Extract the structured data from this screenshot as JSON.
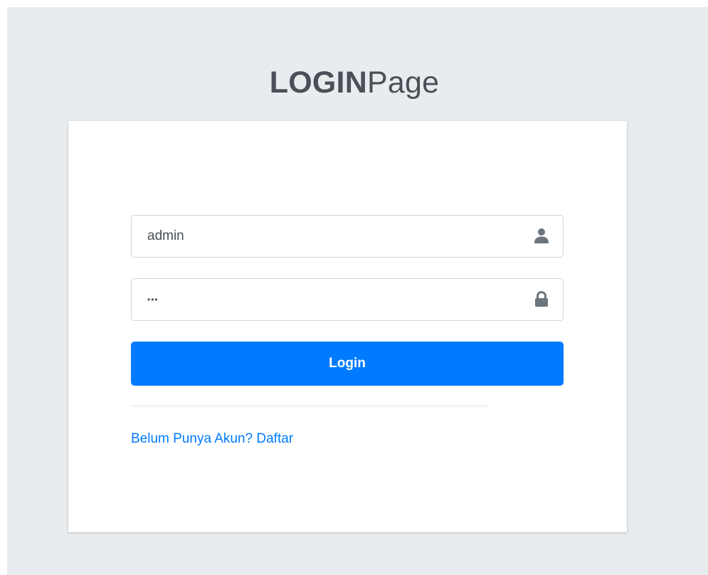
{
  "logo": {
    "bold_text": "LOGIN",
    "light_text": "Page"
  },
  "form": {
    "username": {
      "value": "admin",
      "icon": "user-icon"
    },
    "password": {
      "value": "•••",
      "icon": "lock-icon"
    },
    "login_label": "Login",
    "register_link": "Belum Punya Akun? Daftar"
  },
  "colors": {
    "background": "#e9ecef",
    "card": "#ffffff",
    "primary": "#007bff",
    "text": "#495057",
    "icon": "#6c757d"
  }
}
